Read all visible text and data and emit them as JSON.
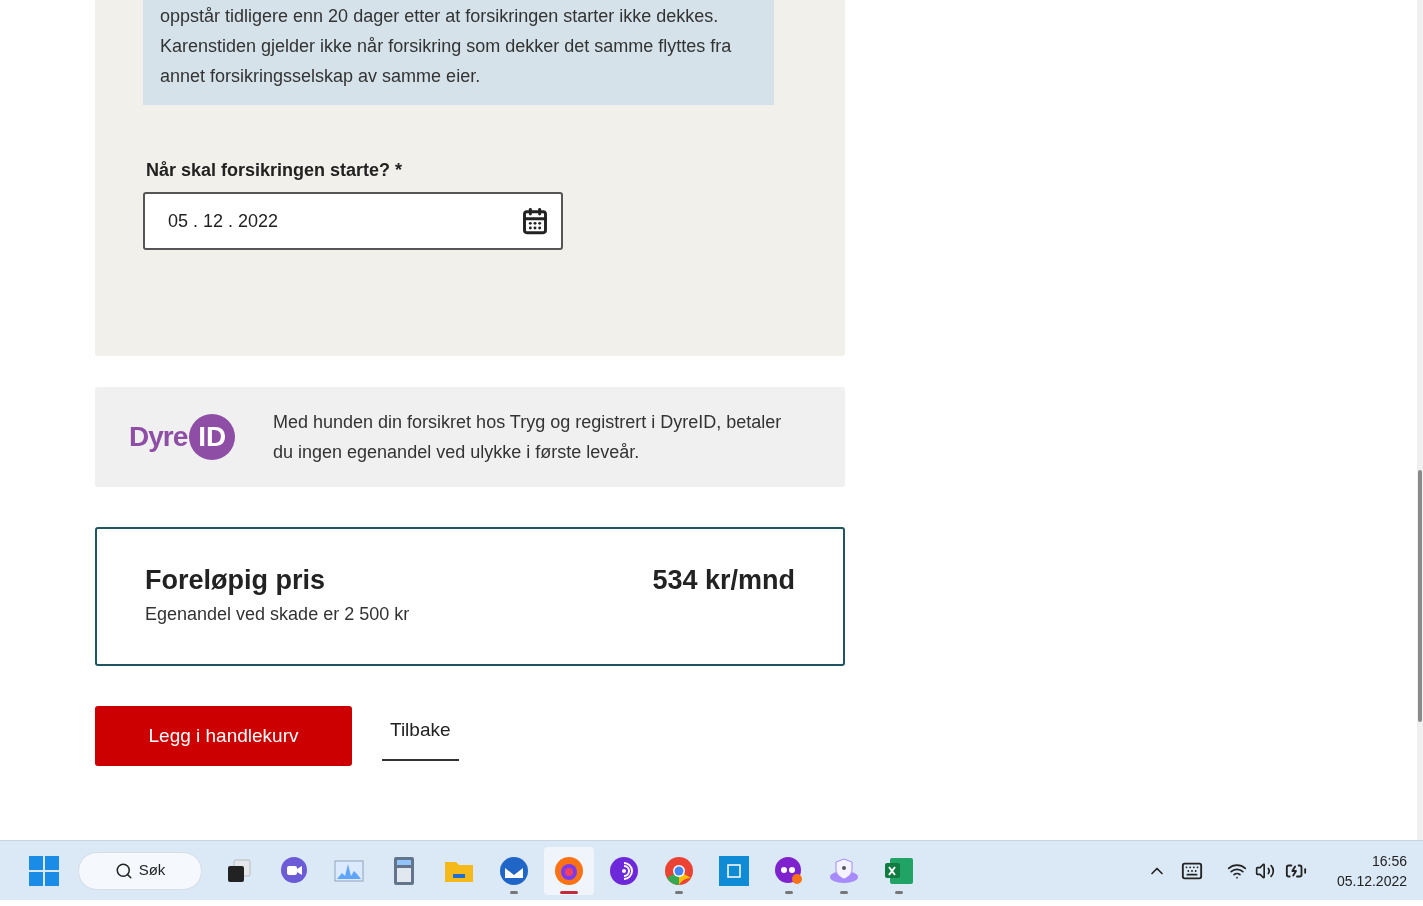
{
  "notice": {
    "text": "oppstår tidligere enn 20 dager etter at forsikringen starter ikke dekkes. Karenstiden gjelder ikke når forsikring som dekker det samme flyttes fra annet forsikringsselskap av samme eier."
  },
  "start_date": {
    "label": "Når skal forsikringen starte? *",
    "value": "05 . 12 . 2022"
  },
  "partner": {
    "logo_word": "Dyre",
    "logo_badge": "ID",
    "text": "Med hunden din forsikret hos Tryg og registrert i DyreID, betaler du ingen egenandel ved ulykke i første leveår."
  },
  "price": {
    "title": "Foreløpig pris",
    "amount": "534 kr/mnd",
    "deductible": "Egenandel ved skade er 2 500 kr"
  },
  "actions": {
    "primary": "Legg i handlekurv",
    "secondary": "Tilbake"
  },
  "taskbar": {
    "search": "Søk",
    "apps": [
      {
        "kind": "taskview",
        "running": false,
        "selected": false
      },
      {
        "kind": "chat",
        "running": false,
        "selected": false
      },
      {
        "kind": "monitor",
        "running": false,
        "selected": false
      },
      {
        "kind": "calculator",
        "running": false,
        "selected": false
      },
      {
        "kind": "folder",
        "running": false,
        "selected": false
      },
      {
        "kind": "mail",
        "running": true,
        "selected": false
      },
      {
        "kind": "browser",
        "running": true,
        "selected": true
      },
      {
        "kind": "podcast",
        "running": false,
        "selected": false
      },
      {
        "kind": "chrome",
        "running": true,
        "selected": false
      },
      {
        "kind": "store",
        "running": false,
        "selected": false
      },
      {
        "kind": "mask",
        "running": true,
        "selected": false
      },
      {
        "kind": "vpn",
        "running": true,
        "selected": false
      },
      {
        "kind": "excel",
        "running": true,
        "selected": false
      }
    ],
    "time": "16:56",
    "date": "05.12.2022"
  }
}
